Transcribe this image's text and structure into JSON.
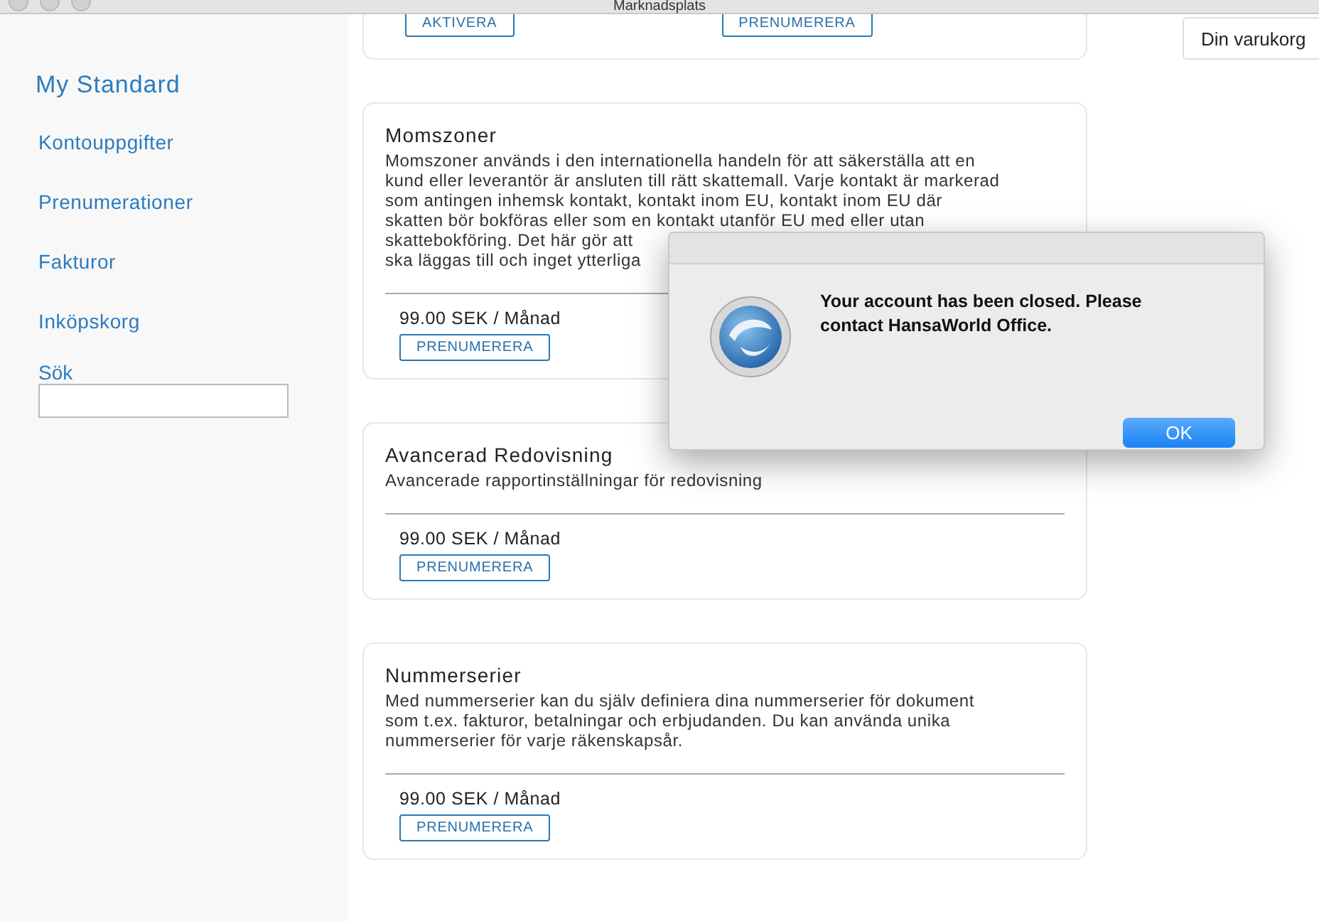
{
  "window": {
    "title": "Marknadsplats"
  },
  "sidebar": {
    "heading": "My Standard",
    "items": [
      {
        "label": "Kontouppgifter"
      },
      {
        "label": "Prenumerationer"
      },
      {
        "label": "Fakturor"
      },
      {
        "label": "Inköpskorg"
      }
    ],
    "search": {
      "label": "Sök"
    }
  },
  "top_card": {
    "buttons": [
      "AKTIVERA",
      "PRENUMERERA"
    ]
  },
  "cards": [
    {
      "title": "Momszoner",
      "description": [
        [
          "Momszoner används i den internationella handeln för att säkerställa att en",
          "kund eller leverantör är ansluten till rätt skattemall. Varje kontakt är markerad",
          "som antingen inhemsk kontakt, kontakt inom EU, kontakt inom EU där",
          "skatten bör bokföras eller som en kontakt utanför EU med eller utan"
        ],
        [
          "skattebokföring. Det här gör att",
          "ska läggas till och inget ytterliga"
        ]
      ],
      "price": "99.00 SEK / Månad",
      "button": "PRENUMERERA"
    },
    {
      "title": "Avancerad Redovisning",
      "description": [
        [
          "Avancerade rapportinställningar för redovisning"
        ]
      ],
      "price": "99.00 SEK / Månad",
      "button": "PRENUMERERA"
    },
    {
      "title": "Nummerserier",
      "description": [
        [
          "Med nummerserier kan du själv definiera dina nummerserier för dokument",
          "som t.ex. fakturor, betalningar och erbjudanden. Du kan använda unika",
          "nummerserier för varje räkenskapsår."
        ]
      ],
      "price": "99.00 SEK / Månad",
      "button": "PRENUMERERA"
    }
  ],
  "cart": {
    "label": "Din varukorg"
  },
  "dialog": {
    "message": "Your account has been closed. Please contact HansaWorld Office.",
    "button": "OK"
  }
}
